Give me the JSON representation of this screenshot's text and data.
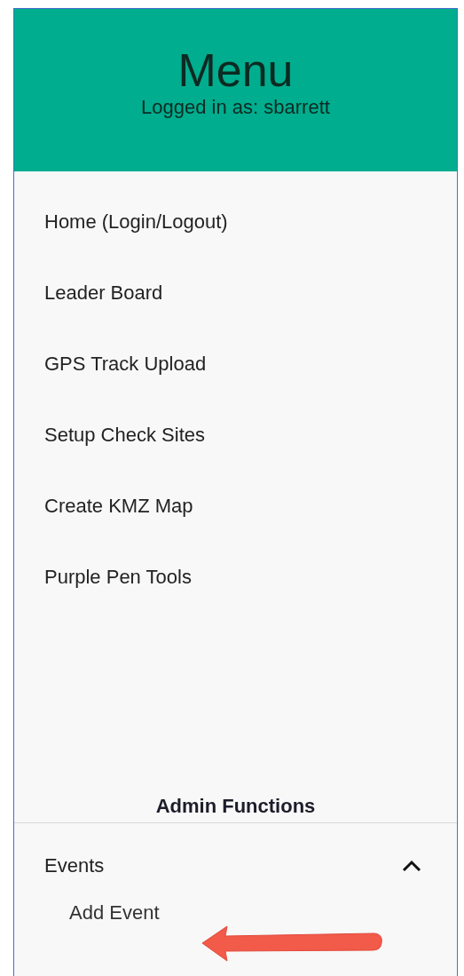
{
  "header": {
    "title": "Menu",
    "subtitle": "Logged in as: sbarrett"
  },
  "menu_items": [
    {
      "label": "Home (Login/Logout)"
    },
    {
      "label": "Leader Board"
    },
    {
      "label": "GPS Track Upload"
    },
    {
      "label": "Setup Check Sites"
    },
    {
      "label": "Create KMZ Map"
    },
    {
      "label": "Purple Pen Tools"
    }
  ],
  "admin": {
    "heading": "Admin Functions",
    "groups": [
      {
        "label": "Events",
        "expanded": true,
        "children": [
          {
            "label": "Add Event"
          }
        ]
      }
    ]
  }
}
